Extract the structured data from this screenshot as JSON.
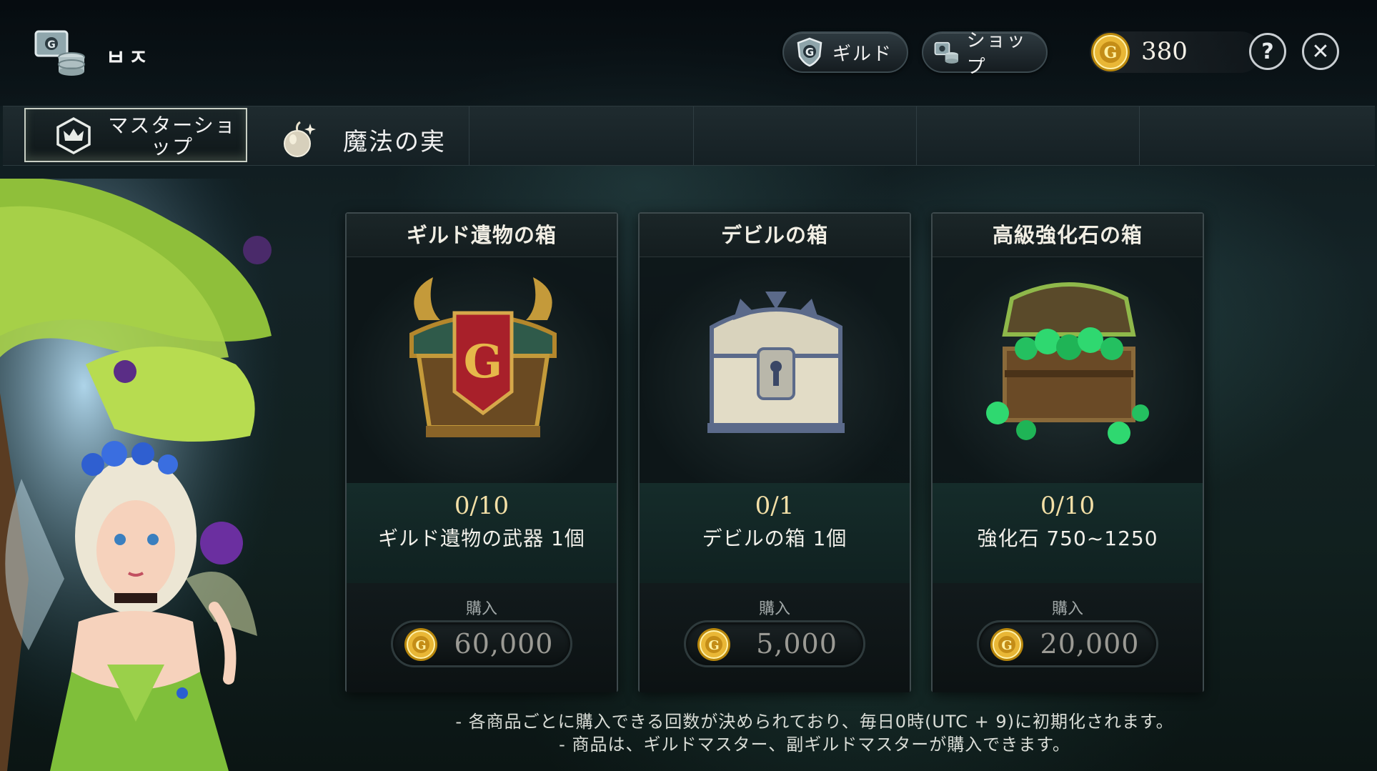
{
  "header": {
    "guild_name": "ㅂㅈ",
    "guild_button_label": "ギルド",
    "shop_button_label": "ショップ",
    "currency_amount": "380",
    "help_label": "?",
    "close_label": "✕"
  },
  "tabs": [
    {
      "label": "マスターショップ",
      "icon": "crown-shield-icon",
      "active": true
    },
    {
      "label": "魔法の実",
      "icon": "magic-fruit-icon",
      "active": false
    }
  ],
  "cards": [
    {
      "title": "ギルド遺物の箱",
      "count": "0/10",
      "description": "ギルド遺物の武器 1個",
      "buy_label": "購入",
      "price": "60,000",
      "image": "guild-relic-chest"
    },
    {
      "title": "デビルの箱",
      "count": "0/1",
      "description": "デビルの箱 1個",
      "buy_label": "購入",
      "price": "5,000",
      "image": "devil-chest"
    },
    {
      "title": "高級強化石の箱",
      "count": "0/10",
      "description": "強化石 750~1250",
      "buy_label": "購入",
      "price": "20,000",
      "image": "enhance-stone-chest"
    }
  ],
  "notes": [
    "- 各商品ごとに購入できる回数が決められており、毎日0時(UTC + 9)に初期化されます。",
    "- 商品は、ギルドマスター、副ギルドマスターが購入できます。"
  ],
  "colors": {
    "accent_gold": "#f3dfa6",
    "price_text": "#9b9a94",
    "info_panel": "#16302e"
  }
}
